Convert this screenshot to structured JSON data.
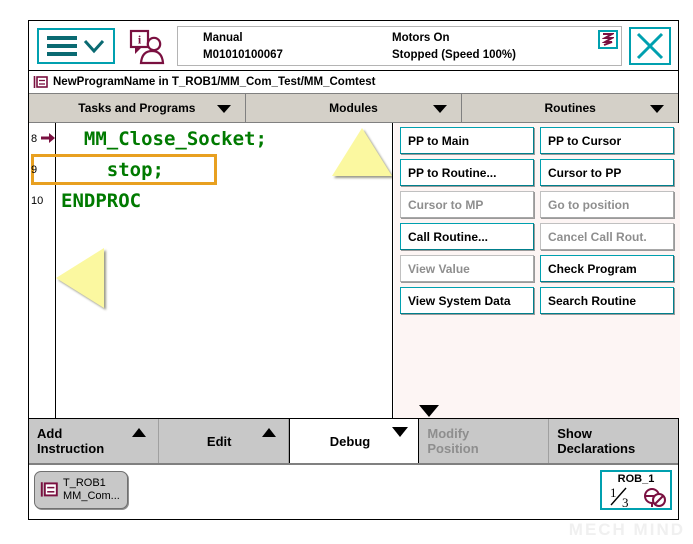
{
  "topbar": {
    "menu_icon": "hamburger-chevron-icon",
    "operator_icon": "operator-info-icon",
    "mode": "Manual",
    "controller_id": "M01010100067",
    "motors": "Motors On",
    "execution": "Stopped (Speed 100%)",
    "exec_icon": "program-execution-icon",
    "close_icon": "close-icon"
  },
  "breadcrumb": {
    "icon": "program-module-icon",
    "text": "NewProgramName  in  T_ROB1/MM_Com_Test/MM_Comtest"
  },
  "selectors": [
    {
      "label": "Tasks and Programs"
    },
    {
      "label": "Modules"
    },
    {
      "label": "Routines"
    }
  ],
  "editor": {
    "lines": [
      {
        "number": "8",
        "code": "  MM_Close_Socket;",
        "highlighted": false,
        "pointer": false
      },
      {
        "number": "9",
        "code": "    stop;",
        "highlighted": true,
        "pointer": true
      },
      {
        "number": "10",
        "code": "ENDPROC",
        "highlighted": false,
        "pointer": false
      }
    ],
    "code_color": "#007a00",
    "highlight_color": "#e8a020",
    "pointer_color": "#7a1040",
    "scroll_up_icon": "scroll-up-triangle-icon",
    "scroll_left_icon": "scroll-left-triangle-icon",
    "scroll_down_icon": "scroll-down-triangle-icon"
  },
  "debug_buttons": [
    {
      "label": "PP to Main",
      "enabled": true
    },
    {
      "label": "PP to Cursor",
      "enabled": true
    },
    {
      "label": "PP to Routine...",
      "enabled": true
    },
    {
      "label": "Cursor to PP",
      "enabled": true
    },
    {
      "label": "Cursor to MP",
      "enabled": false
    },
    {
      "label": "Go to position",
      "enabled": false
    },
    {
      "label": "Call Routine...",
      "enabled": true
    },
    {
      "label": "Cancel Call Rout.",
      "enabled": false
    },
    {
      "label": "View Value",
      "enabled": false
    },
    {
      "label": "Check Program",
      "enabled": true
    },
    {
      "label": "View System Data",
      "enabled": true
    },
    {
      "label": "Search Routine",
      "enabled": true
    }
  ],
  "actionbar": [
    {
      "label": "Add\nInstruction",
      "arrow": "up",
      "state": "normal",
      "align": "left"
    },
    {
      "label": "Edit",
      "arrow": "up",
      "state": "normal",
      "align": "center"
    },
    {
      "label": "Debug",
      "arrow": "down",
      "state": "active",
      "align": "center"
    },
    {
      "label": "Modify\nPosition",
      "arrow": "none",
      "state": "disabled",
      "align": "left"
    },
    {
      "label": "Show\nDeclarations",
      "arrow": "none",
      "state": "normal",
      "align": "left"
    }
  ],
  "taskbar": {
    "chip_icon": "program-module-icon",
    "chip_line1": "T_ROB1",
    "chip_line2": "MM_Com...",
    "robot_title": "ROB_1",
    "robot_fraction_numerator": "1",
    "robot_fraction_denominator": "3",
    "robot_icon": "robot-disabled-icon"
  },
  "watermark": {
    "text": "MECH MIND"
  },
  "theme": {
    "accent_teal": "#00a0af",
    "code_green": "#007a00",
    "highlight_orange": "#e8a020",
    "maroon": "#7a1040",
    "panel_bg": "#fdf5f4",
    "toolbar_gray": "#c8c8c8"
  }
}
